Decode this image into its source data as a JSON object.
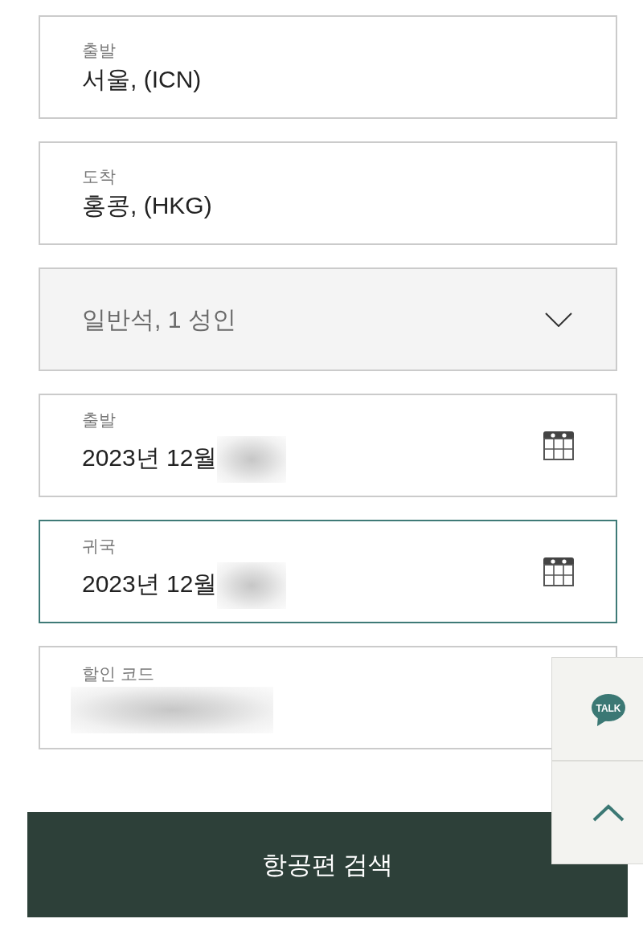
{
  "fields": [
    {
      "kind": "text",
      "label": "출발",
      "value": "서울, (ICN)",
      "focused": false
    },
    {
      "kind": "text",
      "label": "도착",
      "value": "홍콩, (HKG)",
      "focused": false
    },
    {
      "kind": "select",
      "value": "일반석, 1 성인",
      "focused": false
    },
    {
      "kind": "date",
      "label": "출발",
      "value": "2023년 12월",
      "redacted": true,
      "focused": false
    },
    {
      "kind": "date",
      "label": "귀국",
      "value": "2023년 12월",
      "redacted": true,
      "focused": true
    },
    {
      "kind": "code",
      "label": "할인 코드",
      "redacted": true,
      "focused": false
    }
  ],
  "search_button": {
    "label": "항공편 검색"
  },
  "floating_menu": {
    "talk_label": "TALK"
  }
}
